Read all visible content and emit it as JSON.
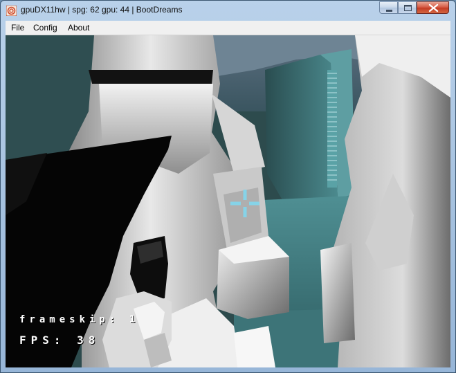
{
  "window": {
    "title": "gpuDX11hw | spg: 62 gpu: 44 | BootDreams",
    "controls": {
      "minimize_icon": "minimize-icon",
      "maximize_icon": "maximize-icon",
      "close_icon": "close-icon"
    }
  },
  "menubar": {
    "file": "File",
    "config": "Config",
    "about": "About"
  },
  "game": {
    "overlay": {
      "frameskip": "frameskip: 1",
      "fps": "FPS: 38"
    },
    "crosshair_color": "#86d3e8"
  },
  "colors": {
    "title_bar": "#b9d1ea",
    "menu_bg": "#f0f0f0",
    "close_button": "#c43b25"
  }
}
